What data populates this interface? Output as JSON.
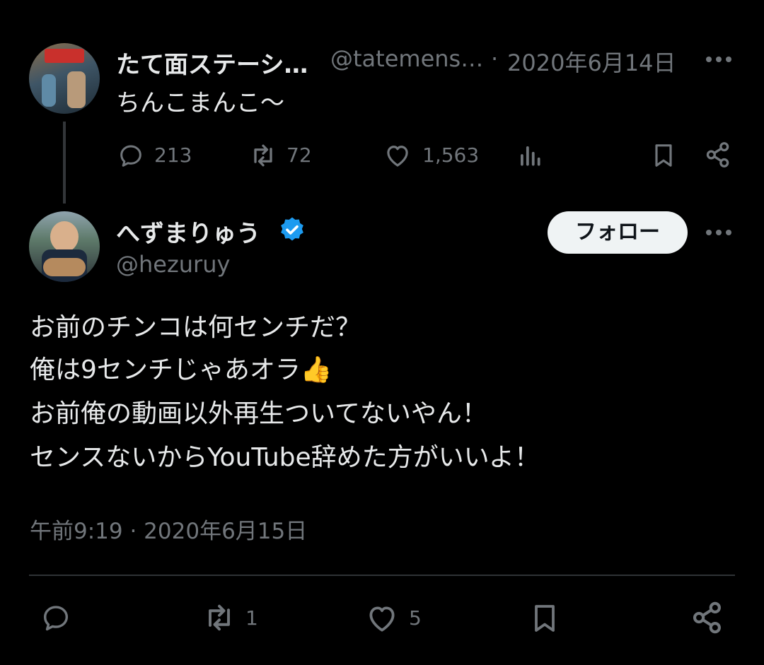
{
  "parent_tweet": {
    "author_name": "たて面ステーシ…",
    "author_handle": "@tatemens…",
    "separator": "·",
    "date": "2020年6月14日",
    "text": "ちんこまんこ〜",
    "stats": {
      "replies": "213",
      "reposts": "72",
      "likes": "1,563"
    }
  },
  "main_tweet": {
    "author_name": "へずまりゅう",
    "author_handle": "@hezuruy",
    "follow_label": "フォロー",
    "text_lines": [
      "お前のチンコは何センチだ？",
      "俺は9センチじゃあオラ",
      "お前俺の動画以外再生ついてないやん！",
      "センスないからYouTube辞めた方がいいよ！"
    ],
    "emoji": "👍",
    "timestamp": "午前9:19 · 2020年6月15日",
    "stats": {
      "reposts": "1",
      "likes": "5"
    }
  },
  "colors": {
    "background": "#000000",
    "text": "#e7e9ea",
    "muted": "#71767b",
    "verified": "#1d9bf0",
    "divider": "#2f3336"
  },
  "icons": [
    "reply-icon",
    "repost-icon",
    "like-icon",
    "views-icon",
    "bookmark-icon",
    "share-icon",
    "more-icon",
    "verified-badge-icon"
  ]
}
